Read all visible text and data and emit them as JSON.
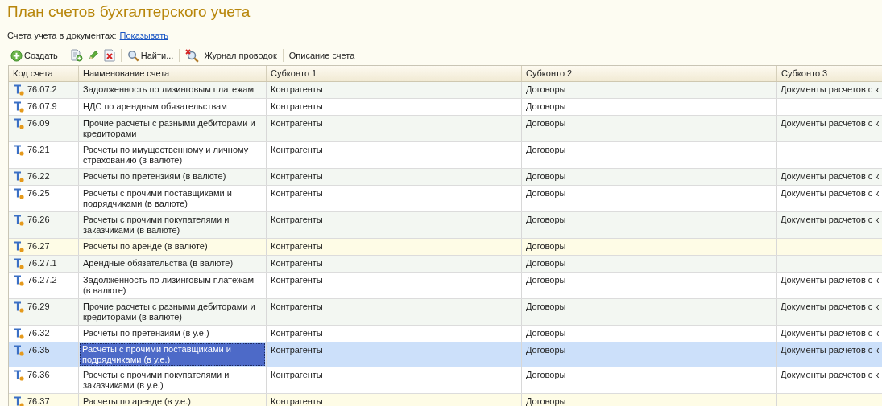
{
  "title": "План счетов бухгалтерского учета",
  "accounts_in_docs": {
    "label": "Счета учета в документах:",
    "link": "Показывать"
  },
  "toolbar": [
    {
      "kind": "create",
      "label": "Создать"
    },
    {
      "kind": "copy",
      "group_start": true
    },
    {
      "kind": "edit"
    },
    {
      "kind": "delete"
    },
    {
      "kind": "find",
      "label": "Найти...",
      "group_start": true
    },
    {
      "kind": "clear-find",
      "group_start": true
    },
    {
      "kind": "text",
      "label": "Журнал проводок"
    },
    {
      "kind": "text",
      "label": "Описание счета",
      "group_start": true
    }
  ],
  "table": {
    "columns": [
      "Код счета",
      "Наименование счета",
      "Субконто 1",
      "Субконто 2",
      "Субконто 3"
    ],
    "rows": [
      {
        "code": "76.07.2",
        "name": "Задолженность по лизинговым платежам",
        "sub1": "Контрагенты",
        "sub2": "Договоры",
        "sub3": "Документы расчетов с к",
        "highlight": false,
        "selected": false
      },
      {
        "code": "76.07.9",
        "name": "НДС по арендным обязательствам",
        "sub1": "Контрагенты",
        "sub2": "Договоры",
        "highlight": false,
        "selected": false
      },
      {
        "code": "76.09",
        "name": "Прочие расчеты с разными дебиторами и кредиторами",
        "sub1": "Контрагенты",
        "sub2": "Договоры",
        "sub3": "Документы расчетов с к",
        "highlight": false,
        "selected": false
      },
      {
        "code": "76.21",
        "name": "Расчеты по имущественному и личному страхованию (в валюте)",
        "sub1": "Контрагенты",
        "sub2": "Договоры",
        "highlight": false,
        "selected": false
      },
      {
        "code": "76.22",
        "name": "Расчеты по претензиям (в валюте)",
        "sub1": "Контрагенты",
        "sub2": "Договоры",
        "sub3": "Документы расчетов с к",
        "highlight": false,
        "selected": false
      },
      {
        "code": "76.25",
        "name": "Расчеты с прочими поставщиками и подрядчиками (в валюте)",
        "sub1": "Контрагенты",
        "sub2": "Договоры",
        "sub3": "Документы расчетов с к",
        "highlight": false,
        "selected": false
      },
      {
        "code": "76.26",
        "name": "Расчеты с прочими покупателями и заказчиками (в валюте)",
        "sub1": "Контрагенты",
        "sub2": "Договоры",
        "sub3": "Документы расчетов с к",
        "highlight": false,
        "selected": false
      },
      {
        "code": "76.27",
        "name": "Расчеты по аренде (в валюте)",
        "sub1": "Контрагенты",
        "sub2": "Договоры",
        "highlight": true,
        "selected": false
      },
      {
        "code": "76.27.1",
        "name": "Арендные обязательства (в валюте)",
        "sub1": "Контрагенты",
        "sub2": "Договоры",
        "highlight": false,
        "selected": false
      },
      {
        "code": "76.27.2",
        "name": "Задолженность по лизинговым платежам (в валюте)",
        "sub1": "Контрагенты",
        "sub2": "Договоры",
        "sub3": "Документы расчетов с к",
        "highlight": false,
        "selected": false
      },
      {
        "code": "76.29",
        "name": "Прочие расчеты с разными дебиторами и кредиторами (в валюте)",
        "sub1": "Контрагенты",
        "sub2": "Договоры",
        "sub3": "Документы расчетов с к",
        "highlight": false,
        "selected": false
      },
      {
        "code": "76.32",
        "name": "Расчеты по претензиям (в у.е.)",
        "sub1": "Контрагенты",
        "sub2": "Договоры",
        "sub3": "Документы расчетов с к",
        "highlight": false,
        "selected": false
      },
      {
        "code": "76.35",
        "name": "Расчеты с прочими поставщиками и подрядчиками (в у.е.)",
        "sub1": "Контрагенты",
        "sub2": "Договоры",
        "sub3": "Документы расчетов с к",
        "highlight": false,
        "selected": true
      },
      {
        "code": "76.36",
        "name": "Расчеты с прочими покупателями и заказчиками (в у.е.)",
        "sub1": "Контрагенты",
        "sub2": "Договоры",
        "sub3": "Документы расчетов с к",
        "highlight": false,
        "selected": false
      },
      {
        "code": "76.37",
        "name": "Расчеты по аренде (в у.е.)",
        "sub1": "Контрагенты",
        "sub2": "Договоры",
        "highlight": true,
        "selected": false
      }
    ]
  }
}
